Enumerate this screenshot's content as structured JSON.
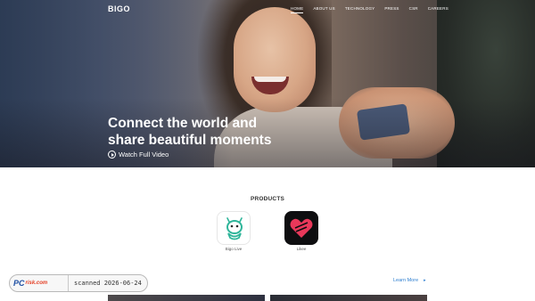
{
  "header": {
    "logo": "BIGO",
    "nav": [
      {
        "label": "HOME",
        "active": true
      },
      {
        "label": "ABOUT US",
        "active": false
      },
      {
        "label": "TECHNOLOGY",
        "active": false
      },
      {
        "label": "PRESS",
        "active": false
      },
      {
        "label": "CSR",
        "active": false
      },
      {
        "label": "CAREERS",
        "active": false
      }
    ]
  },
  "hero": {
    "headline_line1": "Connect the world and",
    "headline_line2": "share beautiful moments",
    "watch_label": "Watch Full Video",
    "watch_icon": "play-circle-icon"
  },
  "products": {
    "title": "PRODUCTS",
    "items": [
      {
        "name": "Bigo Live",
        "icon": "bigo-live-mascot-icon",
        "tile_color": "#ffffff",
        "accent": "#2fb59a"
      },
      {
        "name": "Likee",
        "icon": "likee-heart-icon",
        "tile_color": "#0e0e10",
        "accent": "#e9385a"
      }
    ]
  },
  "learn_more": {
    "label": "Learn More",
    "icon": "arrow-right-icon",
    "color": "#2e7fd0"
  },
  "watermark": {
    "brand_pc": "PC",
    "brand_risk": "risk.com",
    "scan_text": "scanned 2026-06-24"
  }
}
